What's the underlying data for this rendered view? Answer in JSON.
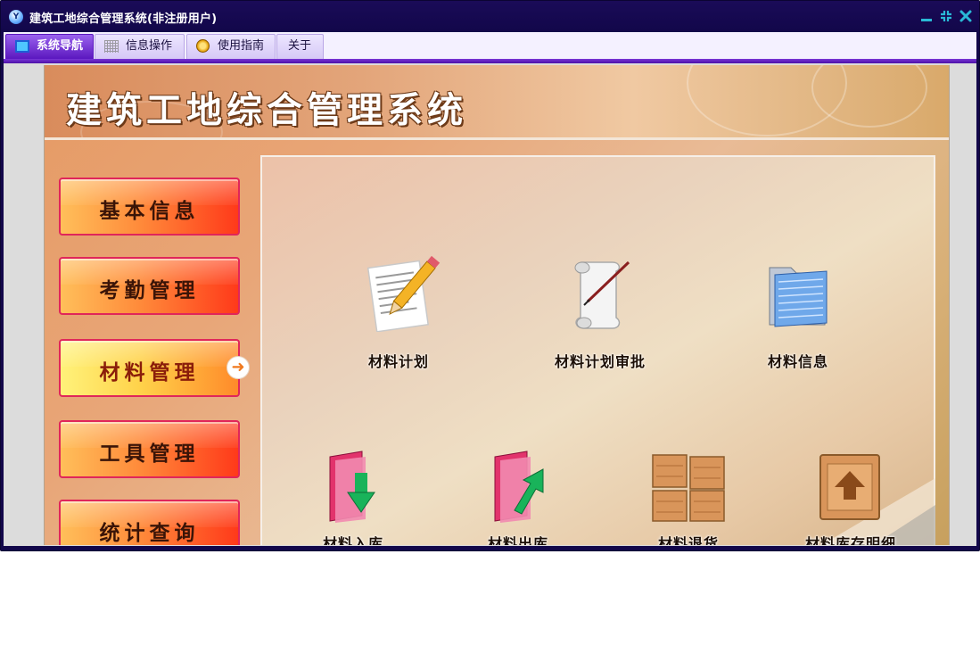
{
  "window": {
    "title": "建筑工地综合管理系统(非注册用户)",
    "logo_text": "Y"
  },
  "menu": {
    "tabs": [
      {
        "label": "系统导航",
        "icon": "monitor-icon",
        "active": true
      },
      {
        "label": "信息操作",
        "icon": "grid-icon",
        "active": false
      },
      {
        "label": "使用指南",
        "icon": "guide-icon",
        "active": false
      },
      {
        "label": "关于",
        "icon": null,
        "active": false
      }
    ]
  },
  "banner": {
    "title": "建筑工地综合管理系统"
  },
  "sidebar": {
    "items": [
      {
        "label": "基本信息",
        "active": false
      },
      {
        "label": "考勤管理",
        "active": false
      },
      {
        "label": "材料管理",
        "active": true
      },
      {
        "label": "工具管理",
        "active": false
      },
      {
        "label": "统计查询",
        "active": false
      }
    ],
    "active_arrow": "➜"
  },
  "panel": {
    "items": [
      {
        "label": "材料计划",
        "icon": "pencil-document-icon"
      },
      {
        "label": "材料计划审批",
        "icon": "scroll-icon"
      },
      {
        "label": "材料信息",
        "icon": "folder-icon"
      },
      {
        "label": "材料入库",
        "icon": "inbound-folder-icon"
      },
      {
        "label": "材料出库",
        "icon": "outbound-folder-icon"
      },
      {
        "label": "材料退货",
        "icon": "crates-icon"
      },
      {
        "label": "材料库存明细",
        "icon": "crate-upload-icon"
      }
    ]
  },
  "colors": {
    "titlebar": "#12074a",
    "menu_accent": "#6a28c9",
    "button_red": "#ff3a1a",
    "button_orange": "#ffbf5a",
    "window_ctrl": "#2ab9d6"
  }
}
